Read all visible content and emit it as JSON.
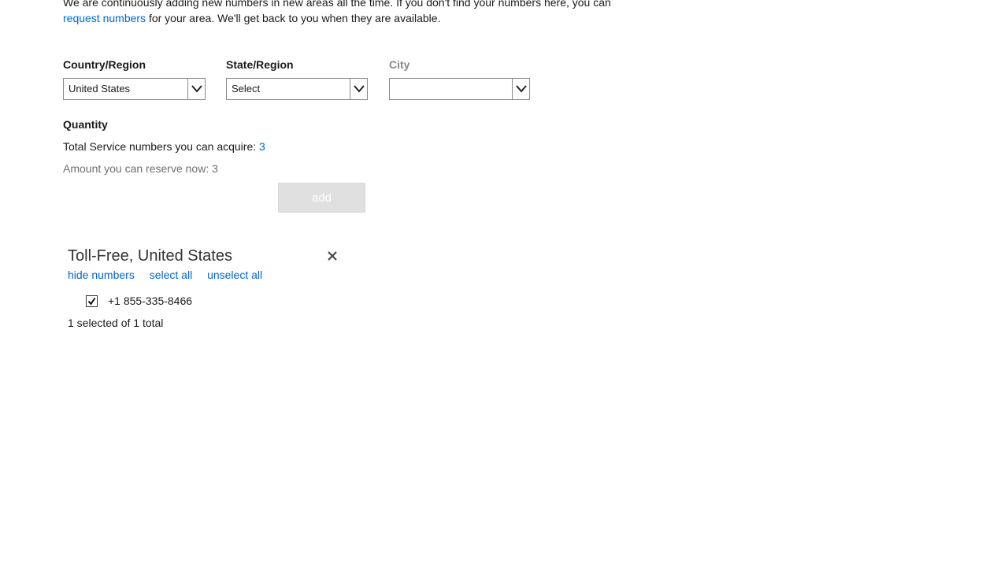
{
  "intro": {
    "line1": "We are continuously adding new numbers in new areas all the time. If you don't find your numbers here, you can",
    "link": "request numbers",
    "line2": " for your area. We'll get back to you when they are available."
  },
  "filters": {
    "country": {
      "label": "Country/Region",
      "value": "United States"
    },
    "state": {
      "label": "State/Region",
      "value": "Select"
    },
    "city": {
      "label": "City",
      "value": ""
    }
  },
  "quantity": {
    "title": "Quantity",
    "total_label": "Total Service numbers you can acquire: ",
    "total_value": "3",
    "reserve_text": "Amount you can reserve now: 3"
  },
  "add_button": {
    "label": "add"
  },
  "number_group": {
    "title": "Toll-Free, United States",
    "actions": [
      "hide numbers",
      "select all",
      "unselect all"
    ],
    "numbers": [
      {
        "number": "+1 855-335-8466",
        "checked": true
      }
    ],
    "count_text": "1 selected of 1 total"
  },
  "colors": {
    "link": "#0066cc",
    "disabled_button": "#e0e0e0"
  }
}
